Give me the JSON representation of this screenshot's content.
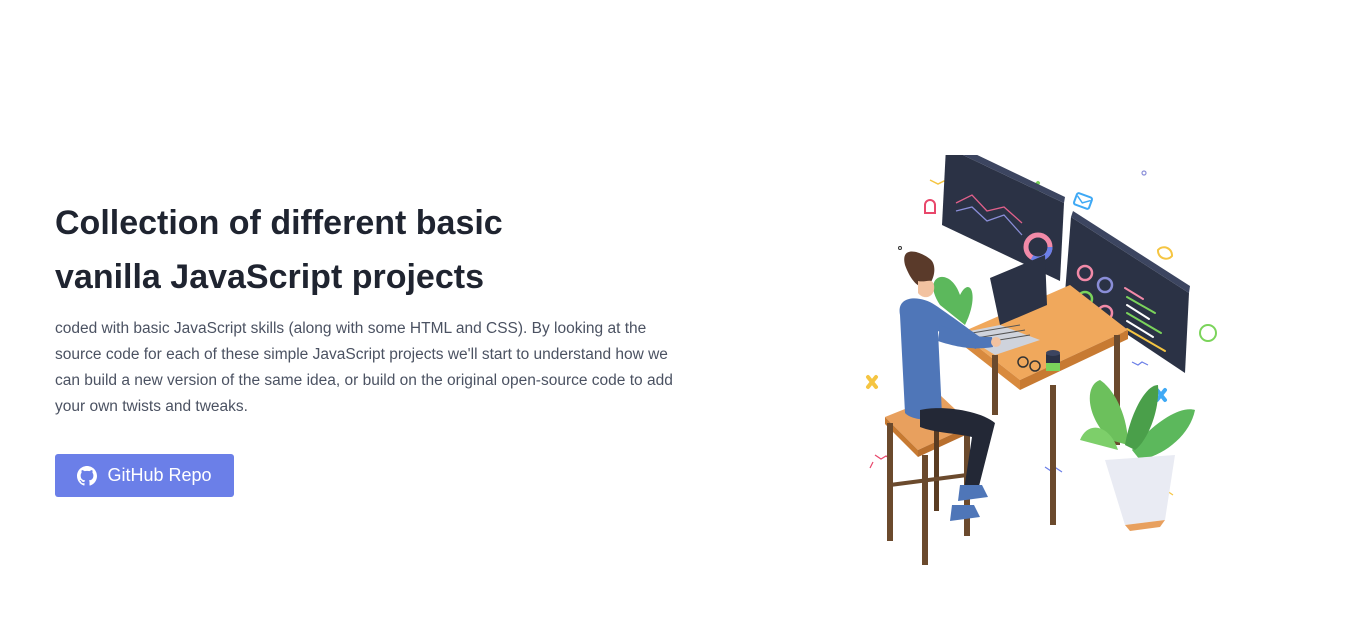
{
  "hero": {
    "title": "Collection of different basic vanilla JavaScript projects",
    "description": "coded with basic JavaScript skills (along with some HTML and CSS). By looking at the source code for each of these simple JavaScript projects we'll start to understand how we can build a new version of the same idea, or build on the original open-source code to add your own twists and tweaks.",
    "button_label": "GitHub Repo",
    "button_icon": "github-icon"
  },
  "colors": {
    "accent": "#6b7fe8",
    "title": "#1f2430",
    "text": "#4b5262"
  }
}
